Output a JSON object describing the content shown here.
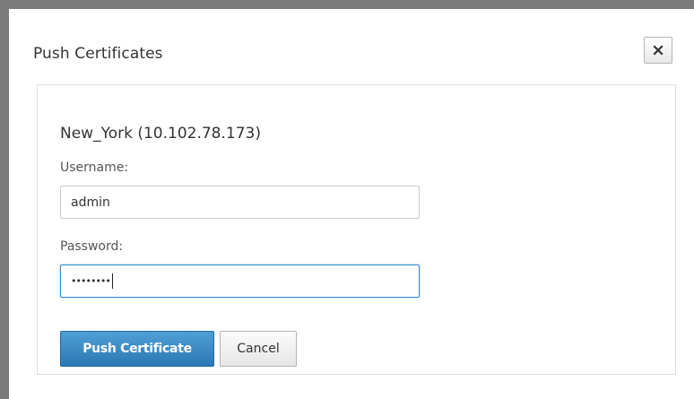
{
  "dialog": {
    "title": "Push Certificates",
    "close_label": "×"
  },
  "form": {
    "node_name": "New_York (10.102.78.173)",
    "username_label": "Username:",
    "username_value": "admin",
    "password_label": "Password:",
    "password_mask": "••••••••"
  },
  "actions": {
    "push_label": "Push Certificate",
    "cancel_label": "Cancel"
  },
  "icons": {
    "close": "close-icon"
  },
  "colors": {
    "primary_button": "#2a78b4",
    "focus_border": "#3a8fcf",
    "text": "#333333"
  }
}
